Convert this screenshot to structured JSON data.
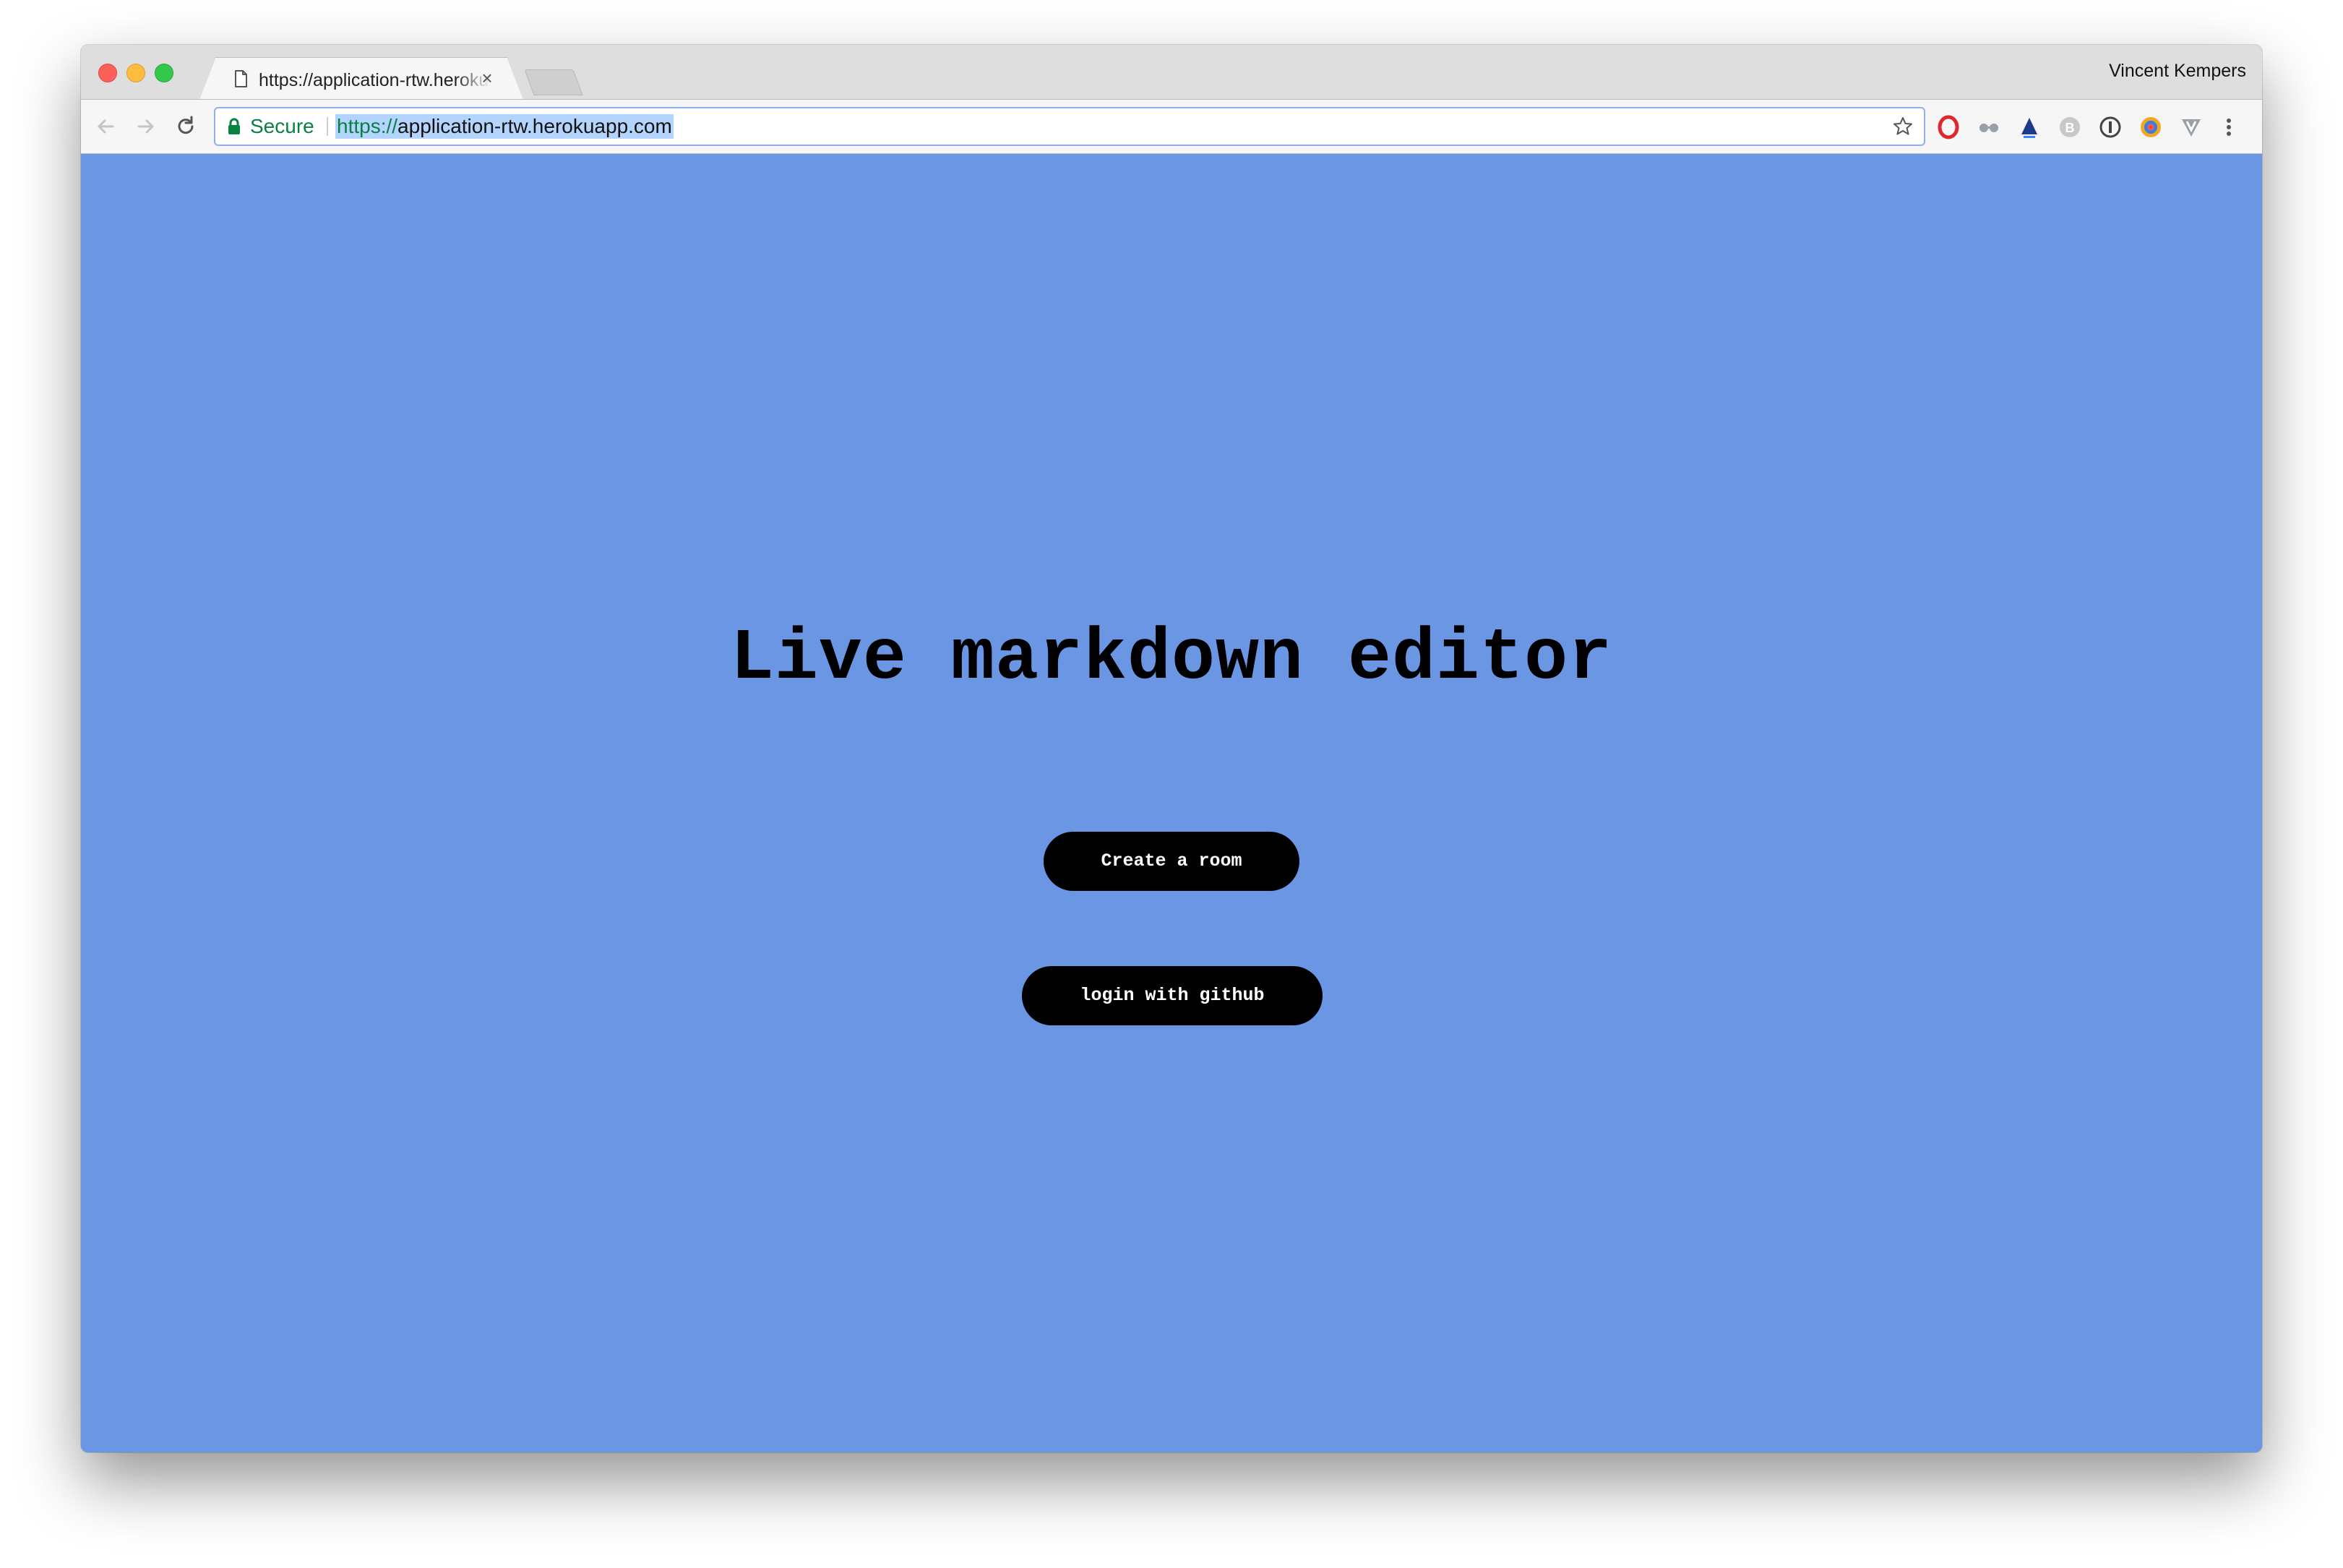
{
  "browser": {
    "tab_title": "https://application-rtw.herokuapp.com",
    "tab_close_glyph": "×",
    "profile_name": "Vincent Kempers",
    "secure_label": "Secure",
    "url_scheme": "https://",
    "url_rest": "application-rtw.herokuapp.com",
    "extensions": [
      "opera-icon",
      "glasses-icon",
      "triangle-icon",
      "b-circle-icon",
      "info-circle-icon",
      "color-circle-icon",
      "v-shield-icon"
    ]
  },
  "page": {
    "title": "Live markdown editor",
    "create_room_label": "Create a room",
    "login_label": "login with github"
  },
  "colors": {
    "page_background": "#6b96e4",
    "button_background": "#000000",
    "button_text": "#ffffff",
    "secure_green": "#0b8043",
    "url_highlight": "#b3d4fd"
  }
}
